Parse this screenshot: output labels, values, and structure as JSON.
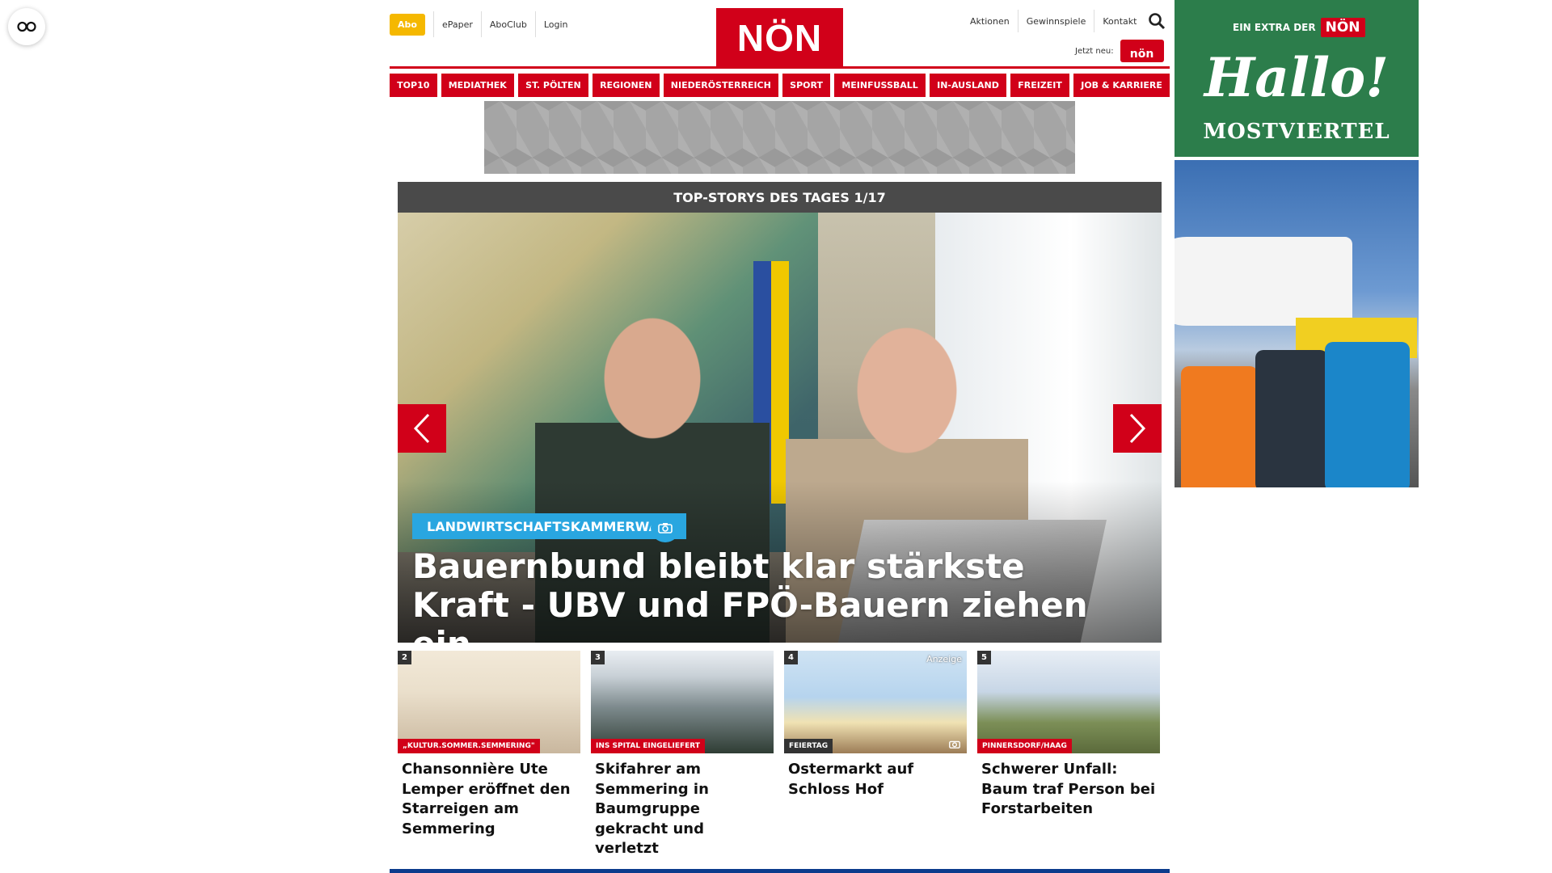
{
  "reader_button": {
    "icon": "reader-glasses-icon"
  },
  "top_nav": {
    "abo": "Abo",
    "left_items": [
      "ePaper",
      "AboClub",
      "Login"
    ],
    "right_items": [
      "Aktionen",
      "Gewinnspiele",
      "Kontakt"
    ],
    "search_icon": "search-icon",
    "jetzt_neu": "Jetzt neu:",
    "jetzt_logo": "nön"
  },
  "logo": {
    "text": "NÖN"
  },
  "main_nav": {
    "items": [
      "TOP10",
      "MEDIATHEK",
      "ST. PÖLTEN",
      "REGIONEN",
      "NIEDERÖSTERREICH",
      "SPORT",
      "MEINFUSSBALL",
      "IN-AUSLAND",
      "FREIZEIT",
      "JOB & KARRIERE"
    ]
  },
  "top_stories": {
    "header": "TOP-STORYS DES TAGES 1/17",
    "hero": {
      "category": "LANDWIRTSCHAFTSKAMMERWAHL",
      "title": "Bauernbund bleibt klar stärkste Kraft - UBV und FPÖ-Bauern ziehen ein"
    },
    "cards": [
      {
        "number": "2",
        "category": "„KULTUR.SOMMER.SEMMERING\"",
        "title": "Chansonnière Ute Lemper eröffnet den Starreigen am Semmering"
      },
      {
        "number": "3",
        "category": "INS SPITAL EINGELIEFERT",
        "title": "Skifahrer am Semmering in Baumgruppe gekracht und verletzt"
      },
      {
        "number": "4",
        "category": "FEIERTAG",
        "badge": "Anzeige",
        "title": "Ostermarkt auf Schloss Hof"
      },
      {
        "number": "5",
        "category": "PINNERSDORF/HAAG",
        "title": "Schwerer Unfall: Baum traf Person bei Forstarbeiten"
      }
    ]
  },
  "ad": {
    "extra": "EIN EXTRA DER",
    "non": "NÖN",
    "hallo": "Hallo!",
    "region": "MOSTVIERTEL"
  },
  "colors": {
    "brand_red": "#d10019",
    "tag_blue": "#29a6e0",
    "abo_yellow": "#f5b800",
    "ad_green": "#2c7d4b"
  }
}
